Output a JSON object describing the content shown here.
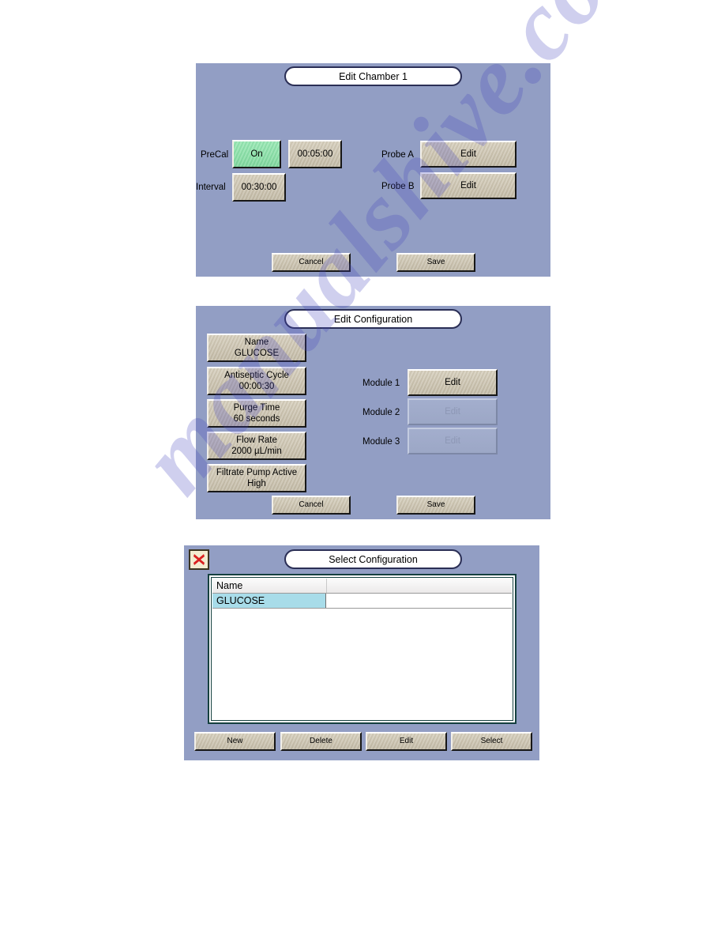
{
  "watermark": {
    "text": "manualshive.com"
  },
  "panels": [
    {
      "id": "edit-chamber",
      "title": "Edit Chamber 1",
      "fields": {
        "precal_label": "PreCal",
        "precal_state": "On",
        "precal_time": "00:05:00",
        "interval_label": "Interval",
        "interval_time": "00:30:00",
        "probe_a_label": "Probe A",
        "probe_a_action": "Edit",
        "probe_b_label": "Probe B",
        "probe_b_action": "Edit"
      },
      "footer": {
        "cancel": "Cancel",
        "save": "Save"
      }
    },
    {
      "id": "edit-configuration",
      "title": "Edit Configuration",
      "settings": [
        {
          "label": "Name",
          "value": "GLUCOSE"
        },
        {
          "label": "Antiseptic Cycle",
          "value": "00:00:30"
        },
        {
          "label": "Purge Time",
          "value": "60 seconds"
        },
        {
          "label": "Flow Rate",
          "value": "2000 µL/min"
        },
        {
          "label": "Filtrate Pump Active",
          "value": "High"
        }
      ],
      "modules": [
        {
          "label": "Module 1",
          "action": "Edit",
          "enabled": true
        },
        {
          "label": "Module 2",
          "action": "Edit",
          "enabled": false
        },
        {
          "label": "Module 3",
          "action": "Edit",
          "enabled": false
        }
      ],
      "footer": {
        "cancel": "Cancel",
        "save": "Save"
      }
    },
    {
      "id": "select-configuration",
      "title": "Select Configuration",
      "close_icon": "close-x-icon",
      "list": {
        "columns": [
          "Name",
          ""
        ],
        "rows": [
          {
            "name": "GLUCOSE",
            "selected": true
          }
        ]
      },
      "footer": {
        "new": "New",
        "delete": "Delete",
        "edit": "Edit",
        "select": "Select"
      }
    }
  ],
  "colors": {
    "panel_bg": "#929ec4",
    "button_face": "#cbc3b0",
    "toggle_on": "#8cdfa8",
    "row_selected": "#a8dce9",
    "title_border": "#2a2e55",
    "close_x": "#d92020"
  }
}
